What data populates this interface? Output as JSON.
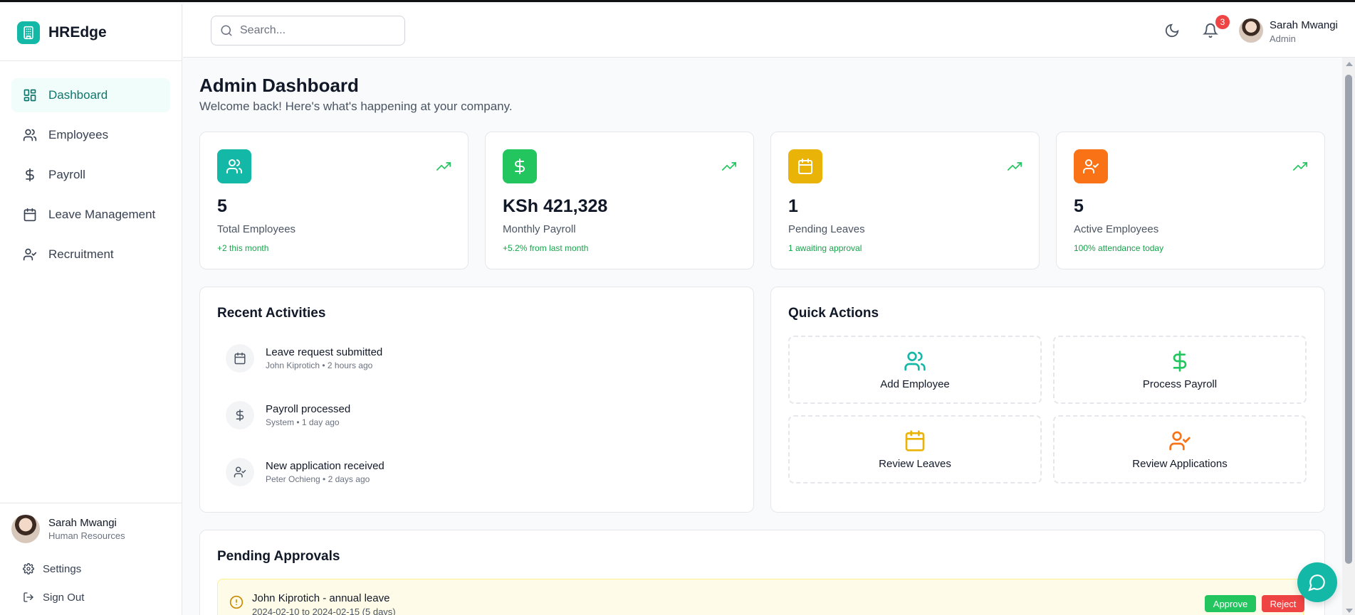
{
  "app": {
    "name": "HREdge"
  },
  "colors": {
    "accent": "#14b8a6",
    "green": "#22c55e",
    "yellow": "#eab308",
    "orange": "#f97316",
    "red": "#ef4444"
  },
  "sidebar": {
    "items": [
      {
        "label": "Dashboard",
        "icon": "layout-dashboard-icon",
        "active": true
      },
      {
        "label": "Employees",
        "icon": "users-icon"
      },
      {
        "label": "Payroll",
        "icon": "dollar-icon"
      },
      {
        "label": "Leave Management",
        "icon": "calendar-icon"
      },
      {
        "label": "Recruitment",
        "icon": "user-check-icon"
      }
    ],
    "user": {
      "name": "Sarah Mwangi",
      "role": "Human Resources"
    },
    "settings_label": "Settings",
    "signout_label": "Sign Out"
  },
  "topbar": {
    "search_placeholder": "Search...",
    "notification_count": "3",
    "user": {
      "name": "Sarah Mwangi",
      "role": "Admin"
    }
  },
  "page": {
    "title": "Admin Dashboard",
    "subtitle": "Welcome back! Here's what's happening at your company."
  },
  "stats": [
    {
      "value": "5",
      "label": "Total Employees",
      "change": "+2 this month",
      "icon": "users-icon",
      "color": "#14b8a6"
    },
    {
      "value": "KSh 421,328",
      "label": "Monthly Payroll",
      "change": "+5.2% from last month",
      "icon": "dollar-icon",
      "color": "#22c55e"
    },
    {
      "value": "1",
      "label": "Pending Leaves",
      "change": "1 awaiting approval",
      "icon": "calendar-icon",
      "color": "#eab308"
    },
    {
      "value": "5",
      "label": "Active Employees",
      "change": "100% attendance today",
      "icon": "user-check-icon",
      "color": "#f97316"
    }
  ],
  "recent_activities": {
    "title": "Recent Activities",
    "items": [
      {
        "title": "Leave request submitted",
        "meta": "John Kiprotich • 2 hours ago",
        "icon": "calendar-icon"
      },
      {
        "title": "Payroll processed",
        "meta": "System • 1 day ago",
        "icon": "dollar-icon"
      },
      {
        "title": "New application received",
        "meta": "Peter Ochieng • 2 days ago",
        "icon": "user-check-icon"
      }
    ]
  },
  "quick_actions": {
    "title": "Quick Actions",
    "items": [
      {
        "label": "Add Employee",
        "icon": "users-icon",
        "color": "#14b8a6"
      },
      {
        "label": "Process Payroll",
        "icon": "dollar-icon",
        "color": "#22c55e"
      },
      {
        "label": "Review Leaves",
        "icon": "calendar-icon",
        "color": "#eab308"
      },
      {
        "label": "Review Applications",
        "icon": "user-check-icon",
        "color": "#f97316"
      }
    ]
  },
  "pending_approvals": {
    "title": "Pending Approvals",
    "items": [
      {
        "title": "John Kiprotich - annual leave",
        "dates": "2024-02-10 to 2024-02-15 (5 days)",
        "approve_label": "Approve",
        "reject_label": "Reject"
      }
    ]
  }
}
